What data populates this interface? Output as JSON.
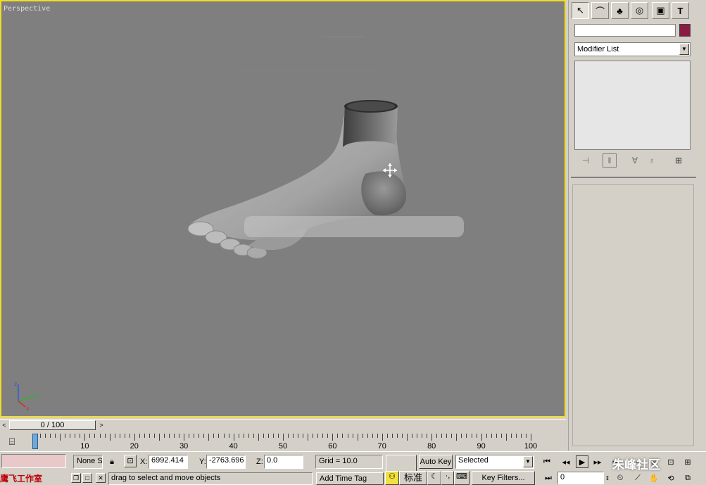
{
  "viewport": {
    "label": "Perspective",
    "border_color": "#f2dc26",
    "background": "#7f7f7f"
  },
  "command_panel": {
    "tabs": [
      {
        "name": "create-tab",
        "icon": "cursor-arrow-icon",
        "glyph": "↖"
      },
      {
        "name": "modify-tab",
        "icon": "bend-arc-icon",
        "glyph": "⌒"
      },
      {
        "name": "hierarchy-tab",
        "icon": "hierarchy-icon",
        "glyph": "♣"
      },
      {
        "name": "motion-tab",
        "icon": "motion-wheel-icon",
        "glyph": "◎"
      },
      {
        "name": "display-tab",
        "icon": "display-monitor-icon",
        "glyph": "▣"
      },
      {
        "name": "utilities-tab",
        "icon": "hammer-icon",
        "glyph": "T"
      }
    ],
    "name_value": "",
    "object_color": "#8b1a43",
    "modifier_list_label": "Modifier List"
  },
  "time_slider": {
    "label": "0 / 100"
  },
  "track_bar": {
    "ticks": [
      {
        "value": 0,
        "label": "0"
      },
      {
        "value": 10,
        "label": "10"
      },
      {
        "value": 20,
        "label": "20"
      },
      {
        "value": 30,
        "label": "30"
      },
      {
        "value": 40,
        "label": "40"
      },
      {
        "value": 50,
        "label": "50"
      },
      {
        "value": 60,
        "label": "60"
      },
      {
        "value": 70,
        "label": "70"
      },
      {
        "value": 80,
        "label": "80"
      },
      {
        "value": 90,
        "label": "90"
      },
      {
        "value": 100,
        "label": "100"
      }
    ],
    "current_frame": 0,
    "max_frame": 100
  },
  "status": {
    "selection": "None S",
    "x_label": "X:",
    "x_value": "6992.414",
    "y_label": "Y:",
    "y_value": "-2763.696",
    "z_label": "Z:",
    "z_value": "0.0",
    "grid": "Grid = 10.0",
    "auto_key": "Auto Key",
    "selected": "Selected",
    "prompt": "drag to select and move objects",
    "add_time_tag": "Add Time Tag",
    "key_filters": "Key Filters...",
    "frame_value": "0",
    "ime_label": "标准",
    "watermark_left": "鹰飞工作室",
    "watermark_right": "朱峰社区"
  }
}
